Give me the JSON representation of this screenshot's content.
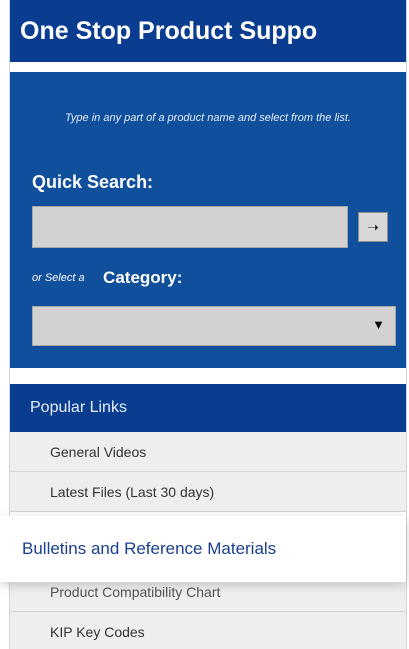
{
  "header": {
    "title": "One Stop Product Suppo"
  },
  "search": {
    "hint": "Type in any part of a product name and select from the list.",
    "quick_search_label": "Quick Search:",
    "quick_search_value": "",
    "go_icon": "arrow-right-icon",
    "go_label": "➝",
    "category_prefix": "or Select a",
    "category_label": "Category:",
    "category_value": "",
    "category_arrow": "▼"
  },
  "popular_links": {
    "header": "Popular Links",
    "items": [
      {
        "label": "General Videos"
      },
      {
        "label": "Latest Files (Last 30 days)"
      },
      {
        "label": "Bulletins and Reference Materials",
        "highlighted": true
      },
      {
        "label": "Product Compatibility Chart"
      },
      {
        "label": "KIP Key Codes"
      }
    ]
  },
  "colors": {
    "title_bg": "#0a3d8f",
    "panel_bg": "#0f4f9c",
    "link_bg": "#eeeeee",
    "highlight_text": "#1a3f8f"
  }
}
